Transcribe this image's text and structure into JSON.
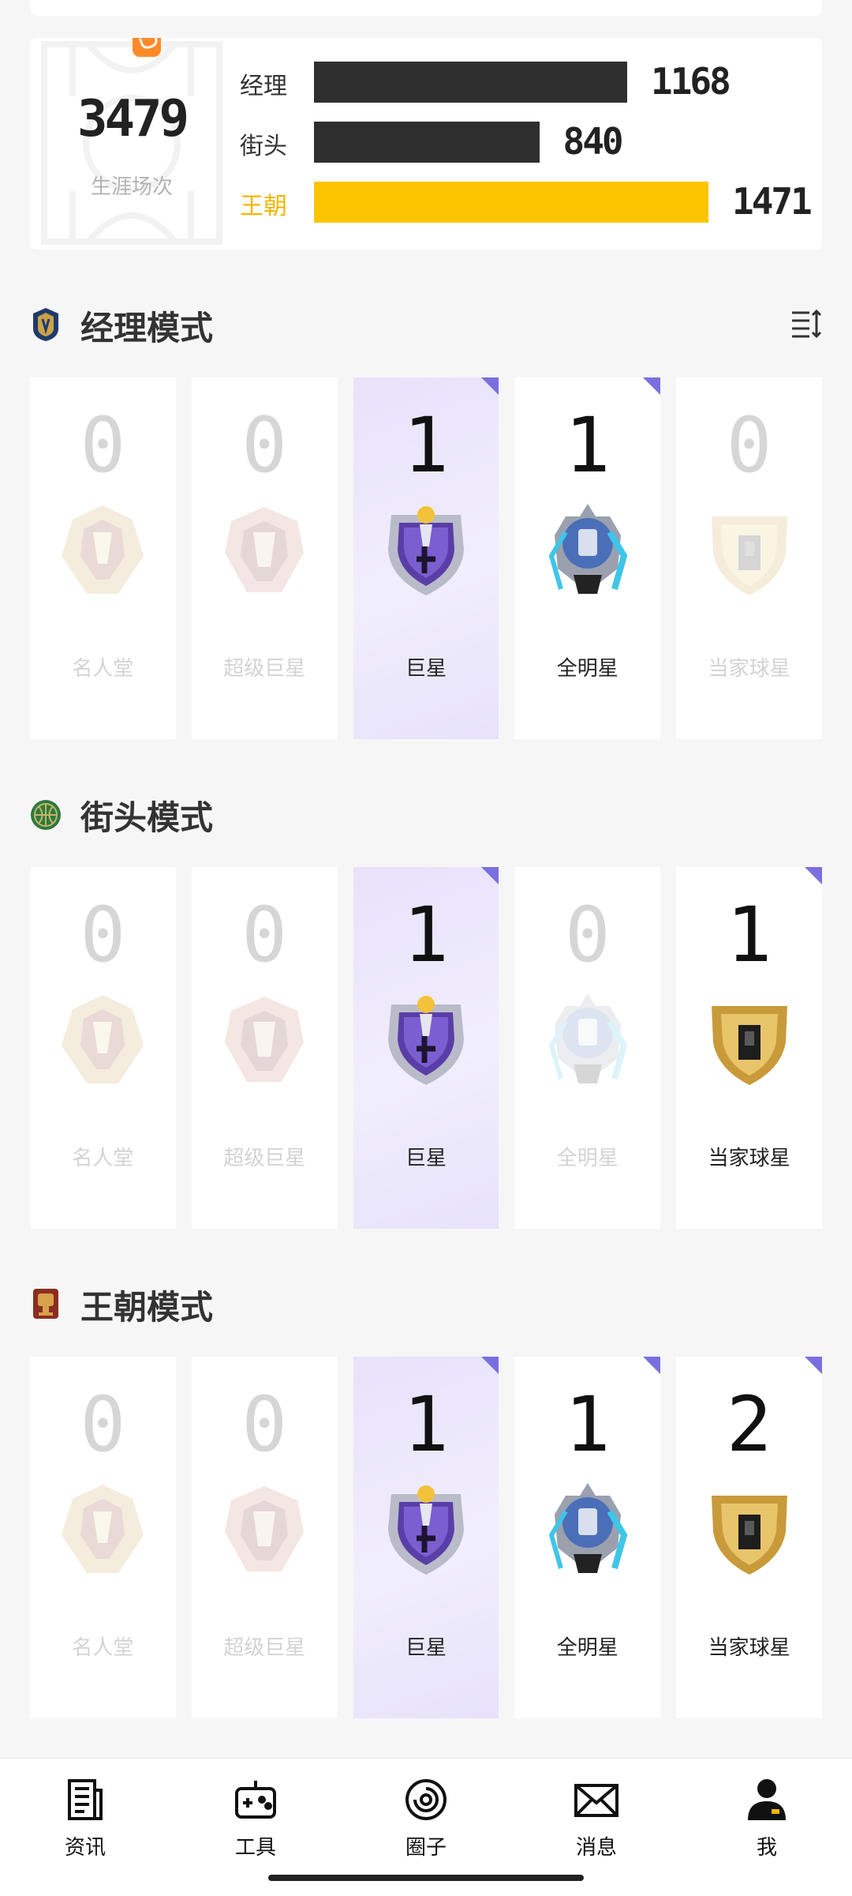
{
  "stats": {
    "career_total": "3479",
    "career_label": "生涯场次",
    "rows": [
      {
        "label": "经理",
        "value": "1168",
        "fraction": 0.794
      },
      {
        "label": "街头",
        "value": "840",
        "fraction": 0.571
      },
      {
        "label": "王朝",
        "value": "1471",
        "fraction": 1.0
      }
    ],
    "accent_color": "#fcc500"
  },
  "sections": [
    {
      "title": "经理模式",
      "icon": "manager-mode-shield-icon",
      "cards": [
        {
          "count": "0",
          "name": "名人堂",
          "badge": "hall-of-fame-badge-icon",
          "active": false
        },
        {
          "count": "0",
          "name": "超级巨星",
          "badge": "superstar-badge-icon",
          "active": false
        },
        {
          "count": "1",
          "name": "巨星",
          "badge": "star-badge-icon",
          "active": true
        },
        {
          "count": "1",
          "name": "全明星",
          "badge": "all-star-badge-icon",
          "active": true
        },
        {
          "count": "0",
          "name": "当家球星",
          "badge": "franchise-star-badge-icon",
          "active": false
        }
      ]
    },
    {
      "title": "街头模式",
      "icon": "street-mode-basketball-icon",
      "cards": [
        {
          "count": "0",
          "name": "名人堂",
          "badge": "hall-of-fame-badge-icon",
          "active": false
        },
        {
          "count": "0",
          "name": "超级巨星",
          "badge": "superstar-badge-icon",
          "active": false
        },
        {
          "count": "1",
          "name": "巨星",
          "badge": "star-badge-icon",
          "active": true
        },
        {
          "count": "0",
          "name": "全明星",
          "badge": "all-star-badge-icon",
          "active": false
        },
        {
          "count": "1",
          "name": "当家球星",
          "badge": "franchise-star-badge-icon",
          "active": true
        }
      ]
    },
    {
      "title": "王朝模式",
      "icon": "dynasty-mode-trophy-icon",
      "cards": [
        {
          "count": "0",
          "name": "名人堂",
          "badge": "hall-of-fame-badge-icon",
          "active": false
        },
        {
          "count": "0",
          "name": "超级巨星",
          "badge": "superstar-badge-icon",
          "active": false
        },
        {
          "count": "1",
          "name": "巨星",
          "badge": "star-badge-icon",
          "active": true
        },
        {
          "count": "1",
          "name": "全明星",
          "badge": "all-star-badge-icon",
          "active": true
        },
        {
          "count": "2",
          "name": "当家球星",
          "badge": "franchise-star-badge-icon",
          "active": true
        }
      ]
    }
  ],
  "nav": [
    {
      "label": "资讯",
      "icon": "news-icon"
    },
    {
      "label": "工具",
      "icon": "gamepad-icon"
    },
    {
      "label": "圈子",
      "icon": "circle-community-icon"
    },
    {
      "label": "消息",
      "icon": "envelope-icon"
    },
    {
      "label": "我",
      "icon": "profile-icon"
    }
  ]
}
